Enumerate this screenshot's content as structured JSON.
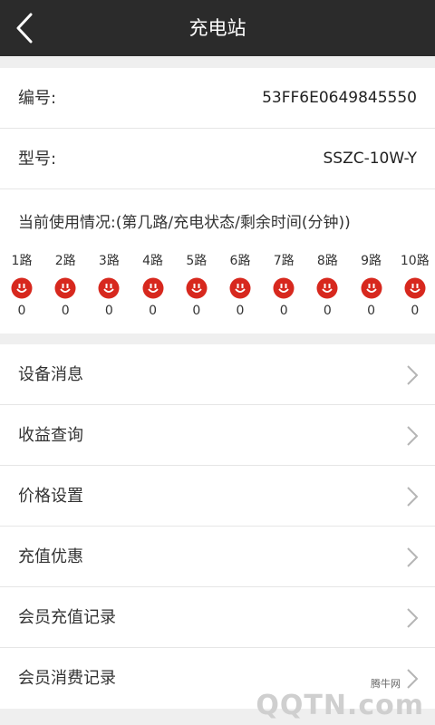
{
  "header": {
    "title": "充电站"
  },
  "device": {
    "id_label": "编号:",
    "id_value": "53FF6E0649845550",
    "model_label": "型号:",
    "model_value": "SSZC-10W-Y"
  },
  "usage": {
    "title": "当前使用情况:(第几路/充电状态/剩余时间(分钟))",
    "ports": [
      {
        "name": "1路",
        "value": "0"
      },
      {
        "name": "2路",
        "value": "0"
      },
      {
        "name": "3路",
        "value": "0"
      },
      {
        "name": "4路",
        "value": "0"
      },
      {
        "name": "5路",
        "value": "0"
      },
      {
        "name": "6路",
        "value": "0"
      },
      {
        "name": "7路",
        "value": "0"
      },
      {
        "name": "8路",
        "value": "0"
      },
      {
        "name": "9路",
        "value": "0"
      },
      {
        "name": "10路",
        "value": "0"
      }
    ],
    "status_icon": "plug-icon",
    "status_color": "#d7281e"
  },
  "menu": {
    "items": [
      {
        "label": "设备消息"
      },
      {
        "label": "收益查询"
      },
      {
        "label": "价格设置"
      },
      {
        "label": "充值优惠"
      },
      {
        "label": "会员充值记录"
      },
      {
        "label": "会员消费记录"
      }
    ]
  },
  "watermark": {
    "small": "腾牛网",
    "big": "QQTN.com"
  },
  "colors": {
    "topbar": "#2b2b2b",
    "background": "#efefef",
    "accent": "#d7281e"
  }
}
